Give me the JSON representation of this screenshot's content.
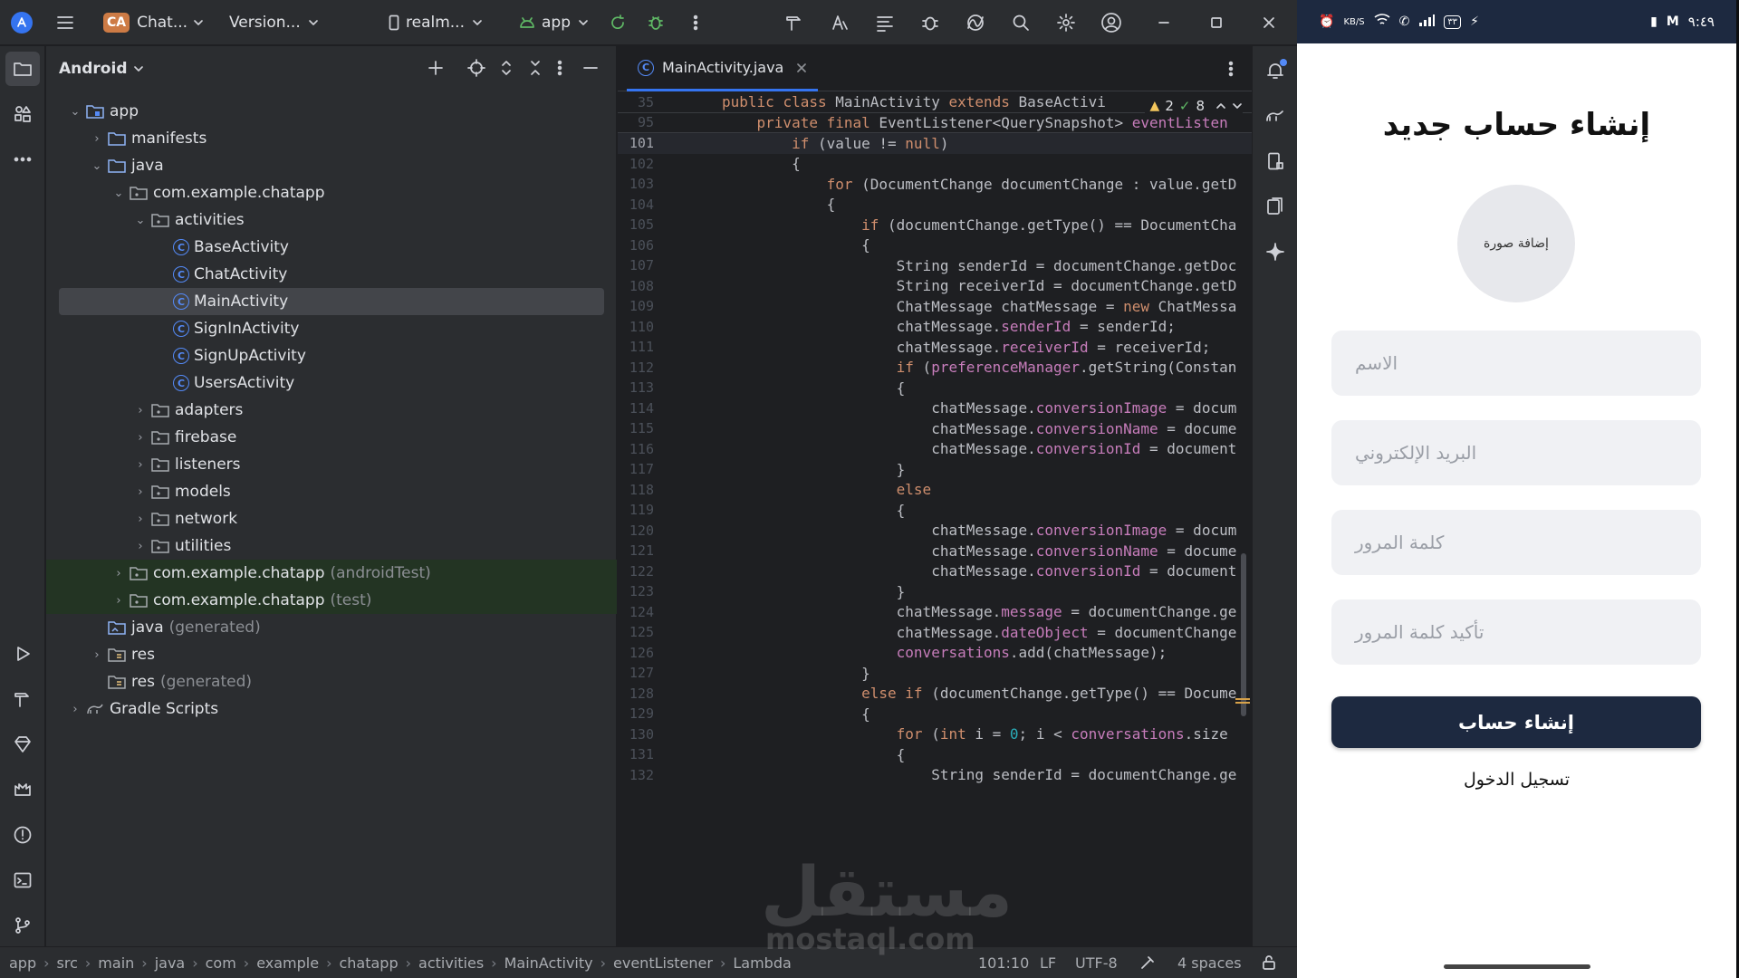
{
  "ide": {
    "toolbar": {
      "project_badge": "CA",
      "project_name": "Chat...",
      "vcs_label": "Version...",
      "device_label": "realm...",
      "run_config": "app"
    },
    "project_panel": {
      "view_label": "Android",
      "tree": [
        {
          "label": "app",
          "suffix": ""
        },
        {
          "label": "manifests",
          "suffix": ""
        },
        {
          "label": "java",
          "suffix": ""
        },
        {
          "label": "com.example.chatapp",
          "suffix": ""
        },
        {
          "label": "activities",
          "suffix": ""
        },
        {
          "label": "BaseActivity",
          "suffix": ""
        },
        {
          "label": "ChatActivity",
          "suffix": ""
        },
        {
          "label": "MainActivity",
          "suffix": ""
        },
        {
          "label": "SignInActivity",
          "suffix": ""
        },
        {
          "label": "SignUpActivity",
          "suffix": ""
        },
        {
          "label": "UsersActivity",
          "suffix": ""
        },
        {
          "label": "adapters",
          "suffix": ""
        },
        {
          "label": "firebase",
          "suffix": ""
        },
        {
          "label": "listeners",
          "suffix": ""
        },
        {
          "label": "models",
          "suffix": ""
        },
        {
          "label": "network",
          "suffix": ""
        },
        {
          "label": "utilities",
          "suffix": ""
        },
        {
          "label": "com.example.chatapp",
          "suffix": "(androidTest)"
        },
        {
          "label": "com.example.chatapp",
          "suffix": "(test)"
        },
        {
          "label": "java",
          "suffix": "(generated)"
        },
        {
          "label": "res",
          "suffix": ""
        },
        {
          "label": "res",
          "suffix": "(generated)"
        },
        {
          "label": "Gradle Scripts",
          "suffix": ""
        }
      ]
    },
    "editor": {
      "tab_title": "MainActivity.java",
      "inspections": {
        "warnings": "2",
        "passed": "8"
      },
      "lines": [
        {
          "n": "35",
          "code": "public class MainActivity extends BaseActivi"
        },
        {
          "n": "95",
          "code": "    private final EventListener<QuerySnapshot> eventListen"
        },
        {
          "n": "101",
          "code": "        if (value != null)"
        },
        {
          "n": "102",
          "code": "        {"
        },
        {
          "n": "103",
          "code": "            for (DocumentChange documentChange : value.getD"
        },
        {
          "n": "104",
          "code": "            {"
        },
        {
          "n": "105",
          "code": "                if (documentChange.getType() == DocumentCha"
        },
        {
          "n": "106",
          "code": "                {"
        },
        {
          "n": "107",
          "code": "                    String senderId = documentChange.getDoc"
        },
        {
          "n": "108",
          "code": "                    String receiverId = documentChange.getD"
        },
        {
          "n": "109",
          "code": "                    ChatMessage chatMessage = new ChatMessa"
        },
        {
          "n": "110",
          "code": "                    chatMessage.senderId = senderId;"
        },
        {
          "n": "111",
          "code": "                    chatMessage.receiverId = receiverId;"
        },
        {
          "n": "112",
          "code": "                    if (preferenceManager.getString(Constan"
        },
        {
          "n": "113",
          "code": "                    {"
        },
        {
          "n": "114",
          "code": "                        chatMessage.conversionImage = docum"
        },
        {
          "n": "115",
          "code": "                        chatMessage.conversionName = docume"
        },
        {
          "n": "116",
          "code": "                        chatMessage.conversionId = document"
        },
        {
          "n": "117",
          "code": "                    }"
        },
        {
          "n": "118",
          "code": "                    else"
        },
        {
          "n": "119",
          "code": "                    {"
        },
        {
          "n": "120",
          "code": "                        chatMessage.conversionImage = docum"
        },
        {
          "n": "121",
          "code": "                        chatMessage.conversionName = docume"
        },
        {
          "n": "122",
          "code": "                        chatMessage.conversionId = document"
        },
        {
          "n": "123",
          "code": "                    }"
        },
        {
          "n": "124",
          "code": "                    chatMessage.message = documentChange.ge"
        },
        {
          "n": "125",
          "code": "                    chatMessage.dateObject = documentChange"
        },
        {
          "n": "126",
          "code": "                    conversations.add(chatMessage);"
        },
        {
          "n": "127",
          "code": "                }"
        },
        {
          "n": "128",
          "code": "                else if (documentChange.getType() == Docume"
        },
        {
          "n": "129",
          "code": "                {"
        },
        {
          "n": "130",
          "code": "                    for (int i = 0; i < conversations.size"
        },
        {
          "n": "131",
          "code": "                    {"
        },
        {
          "n": "132",
          "code": "                        String senderId = documentChange.ge"
        }
      ]
    },
    "statusbar": {
      "breadcrumbs": [
        "app",
        "src",
        "main",
        "java",
        "com",
        "example",
        "chatapp",
        "activities",
        "MainActivity",
        "eventListener",
        "Lambda"
      ],
      "position": "101:10",
      "line_sep": "LF",
      "encoding": "UTF-8",
      "indent": "4 spaces"
    },
    "watermark": {
      "arabic": "مستقل",
      "latin": "mostaql.com"
    }
  },
  "phone": {
    "status": {
      "time": "٩:٤٩",
      "speed": "KB/S",
      "battery": "٣٣"
    },
    "title": "إنشاء حساب جديد",
    "avatar_label": "إضافة صورة",
    "fields": {
      "name": "الاسم",
      "email": "البريد الإلكتروني",
      "password": "كلمة المرور",
      "confirm": "تأكيد كلمة المرور"
    },
    "submit_label": "إنشاء حساب",
    "login_link": "تسجيل الدخول"
  },
  "colors": {
    "ide_bg": "#1e1f22",
    "panel_bg": "#2b2d30",
    "accent": "#3574f0",
    "keyword": "#cf8e6d",
    "field": "#c77dbb",
    "phone_status": "#1d2940",
    "submit_button": "#1d2940"
  }
}
